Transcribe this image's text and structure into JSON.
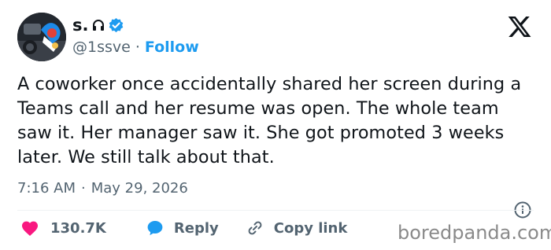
{
  "author": {
    "display_name": "s.",
    "handle": "@1ssve",
    "follow_label": "Follow",
    "separator": "·"
  },
  "tweet": {
    "text": "A coworker once accidentally shared her screen during a Teams call and her resume was open. The whole team saw it. Her manager saw it. She got promoted 3 weeks later. We still talk about that.",
    "time": "7:16 AM",
    "date": "May 29, 2026",
    "separator": "·"
  },
  "actions": {
    "likes": "130.7K",
    "reply_label": "Reply",
    "copy_label": "Copy link"
  },
  "watermark": "boredpanda.com",
  "icons": {
    "platform": "x-logo-icon",
    "verified": "verified-badge-icon",
    "name_glyph": "headphones-icon",
    "like": "heart-icon",
    "reply": "speech-bubble-icon",
    "copy": "link-icon",
    "info": "info-icon"
  },
  "colors": {
    "accent": "#1d9bf0",
    "like": "#f91880",
    "text": "#0f1419",
    "muted": "#536471"
  }
}
